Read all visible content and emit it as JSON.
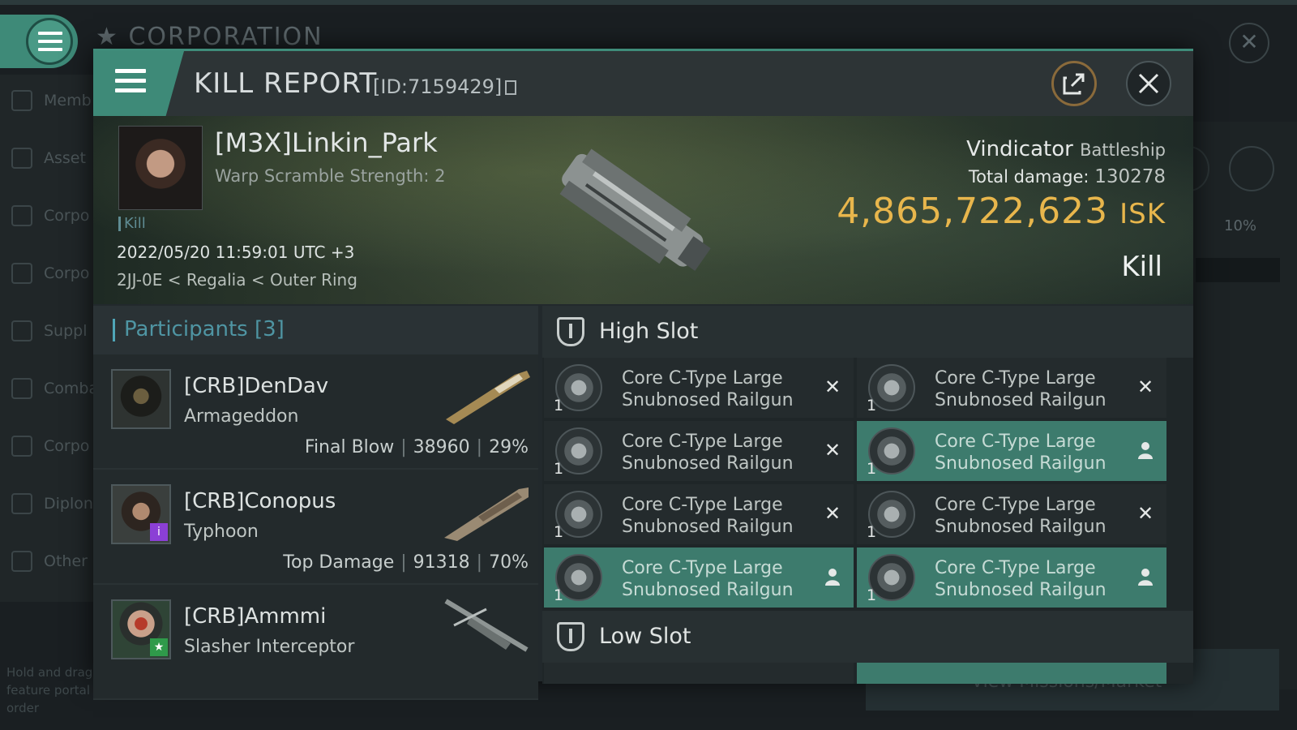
{
  "background": {
    "title": "CORPORATION",
    "sidebar": [
      "Memb",
      "Asset",
      "Corpo",
      "Corpo",
      "Suppl",
      "Comba",
      "Corpo",
      "Diplon",
      "Other"
    ],
    "percent": "10%",
    "hint": "Hold and drag feature portal order",
    "market_button": "View Missions/Market"
  },
  "header": {
    "title": "KILL REPORT",
    "id_text": "[ID:7159429]"
  },
  "victim": {
    "name": "[M3X]Linkin_Park",
    "warp_scramble": "Warp Scramble Strength: 2",
    "kill_tag": "Kill",
    "datetime": "2022/05/20 11:59:01 UTC +3",
    "location": "2JJ-0E < Regalia < Outer Ring",
    "ship": "Vindicator",
    "ship_class": "Battleship",
    "total_damage_label": "Total damage:",
    "total_damage": "130278",
    "isk_value": "4,865,722,623",
    "isk_unit": "ISK",
    "result": "Kill"
  },
  "participants": {
    "label": "Participants [3]",
    "items": [
      {
        "name": "[CRB]DenDav",
        "ship": "Armageddon",
        "role": "Final Blow",
        "damage": "38960",
        "percent": "29%"
      },
      {
        "name": "[CRB]Conopus",
        "ship": "Typhoon",
        "role": "Top Damage",
        "damage": "91318",
        "percent": "70%"
      },
      {
        "name": "[CRB]Ammmi",
        "ship": "Slasher Interceptor",
        "role": "",
        "damage": "",
        "percent": ""
      }
    ]
  },
  "fitting": {
    "high_slot_label": "High Slot",
    "low_slot_label": "Low Slot",
    "high_slots": [
      {
        "name": "Core C-Type Large Snubnosed Railgun",
        "qty": "1",
        "status": "destroyed"
      },
      {
        "name": "Core C-Type Large Snubnosed Railgun",
        "qty": "1",
        "status": "destroyed"
      },
      {
        "name": "Core C-Type Large Snubnosed Railgun",
        "qty": "1",
        "status": "destroyed"
      },
      {
        "name": "Core C-Type Large Snubnosed Railgun",
        "qty": "1",
        "status": "dropped"
      },
      {
        "name": "Core C-Type Large Snubnosed Railgun",
        "qty": "1",
        "status": "destroyed"
      },
      {
        "name": "Core C-Type Large Snubnosed Railgun",
        "qty": "1",
        "status": "destroyed"
      },
      {
        "name": "Core C-Type Large Snubnosed Railgun",
        "qty": "1",
        "status": "dropped"
      },
      {
        "name": "Core C-Type Large Snubnosed Railgun",
        "qty": "1",
        "status": "dropped"
      }
    ]
  },
  "colors": {
    "accent": "#3e8a78",
    "isk": "#e8b64c",
    "participants_label": "#4f95a3"
  }
}
